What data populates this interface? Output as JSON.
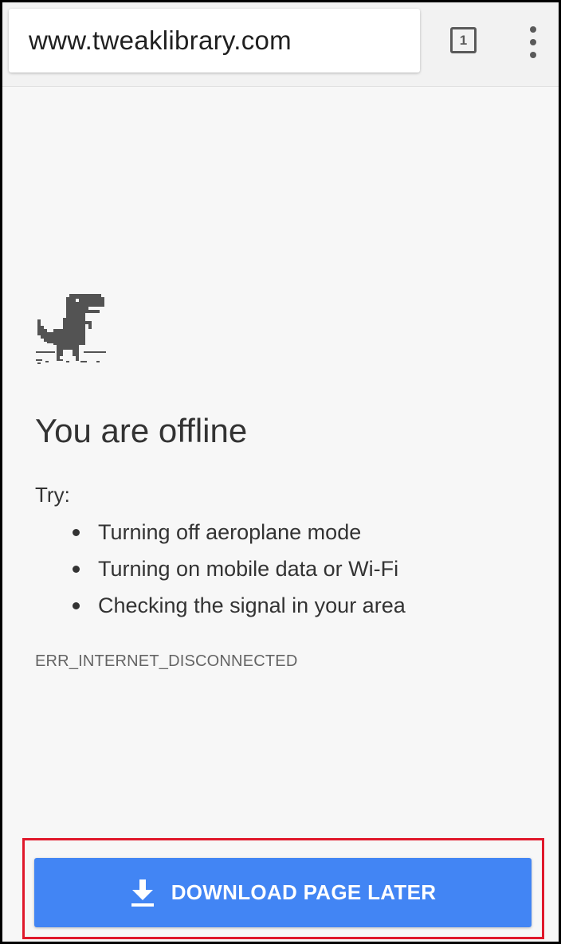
{
  "toolbar": {
    "url": "www.tweaklibrary.com",
    "tab_count": "1",
    "menu_icon": "more-vertical-icon"
  },
  "offline_page": {
    "icon": "dino-icon",
    "title": "You are offline",
    "try_label": "Try:",
    "suggestions": [
      "Turning off aeroplane mode",
      "Turning on mobile data or Wi-Fi",
      "Checking the signal in your area"
    ],
    "error_code": "ERR_INTERNET_DISCONNECTED"
  },
  "download_button": {
    "label": "DOWNLOAD PAGE LATER",
    "icon": "download-icon",
    "color": "#4285f4"
  },
  "highlight_color": "#e0182b"
}
